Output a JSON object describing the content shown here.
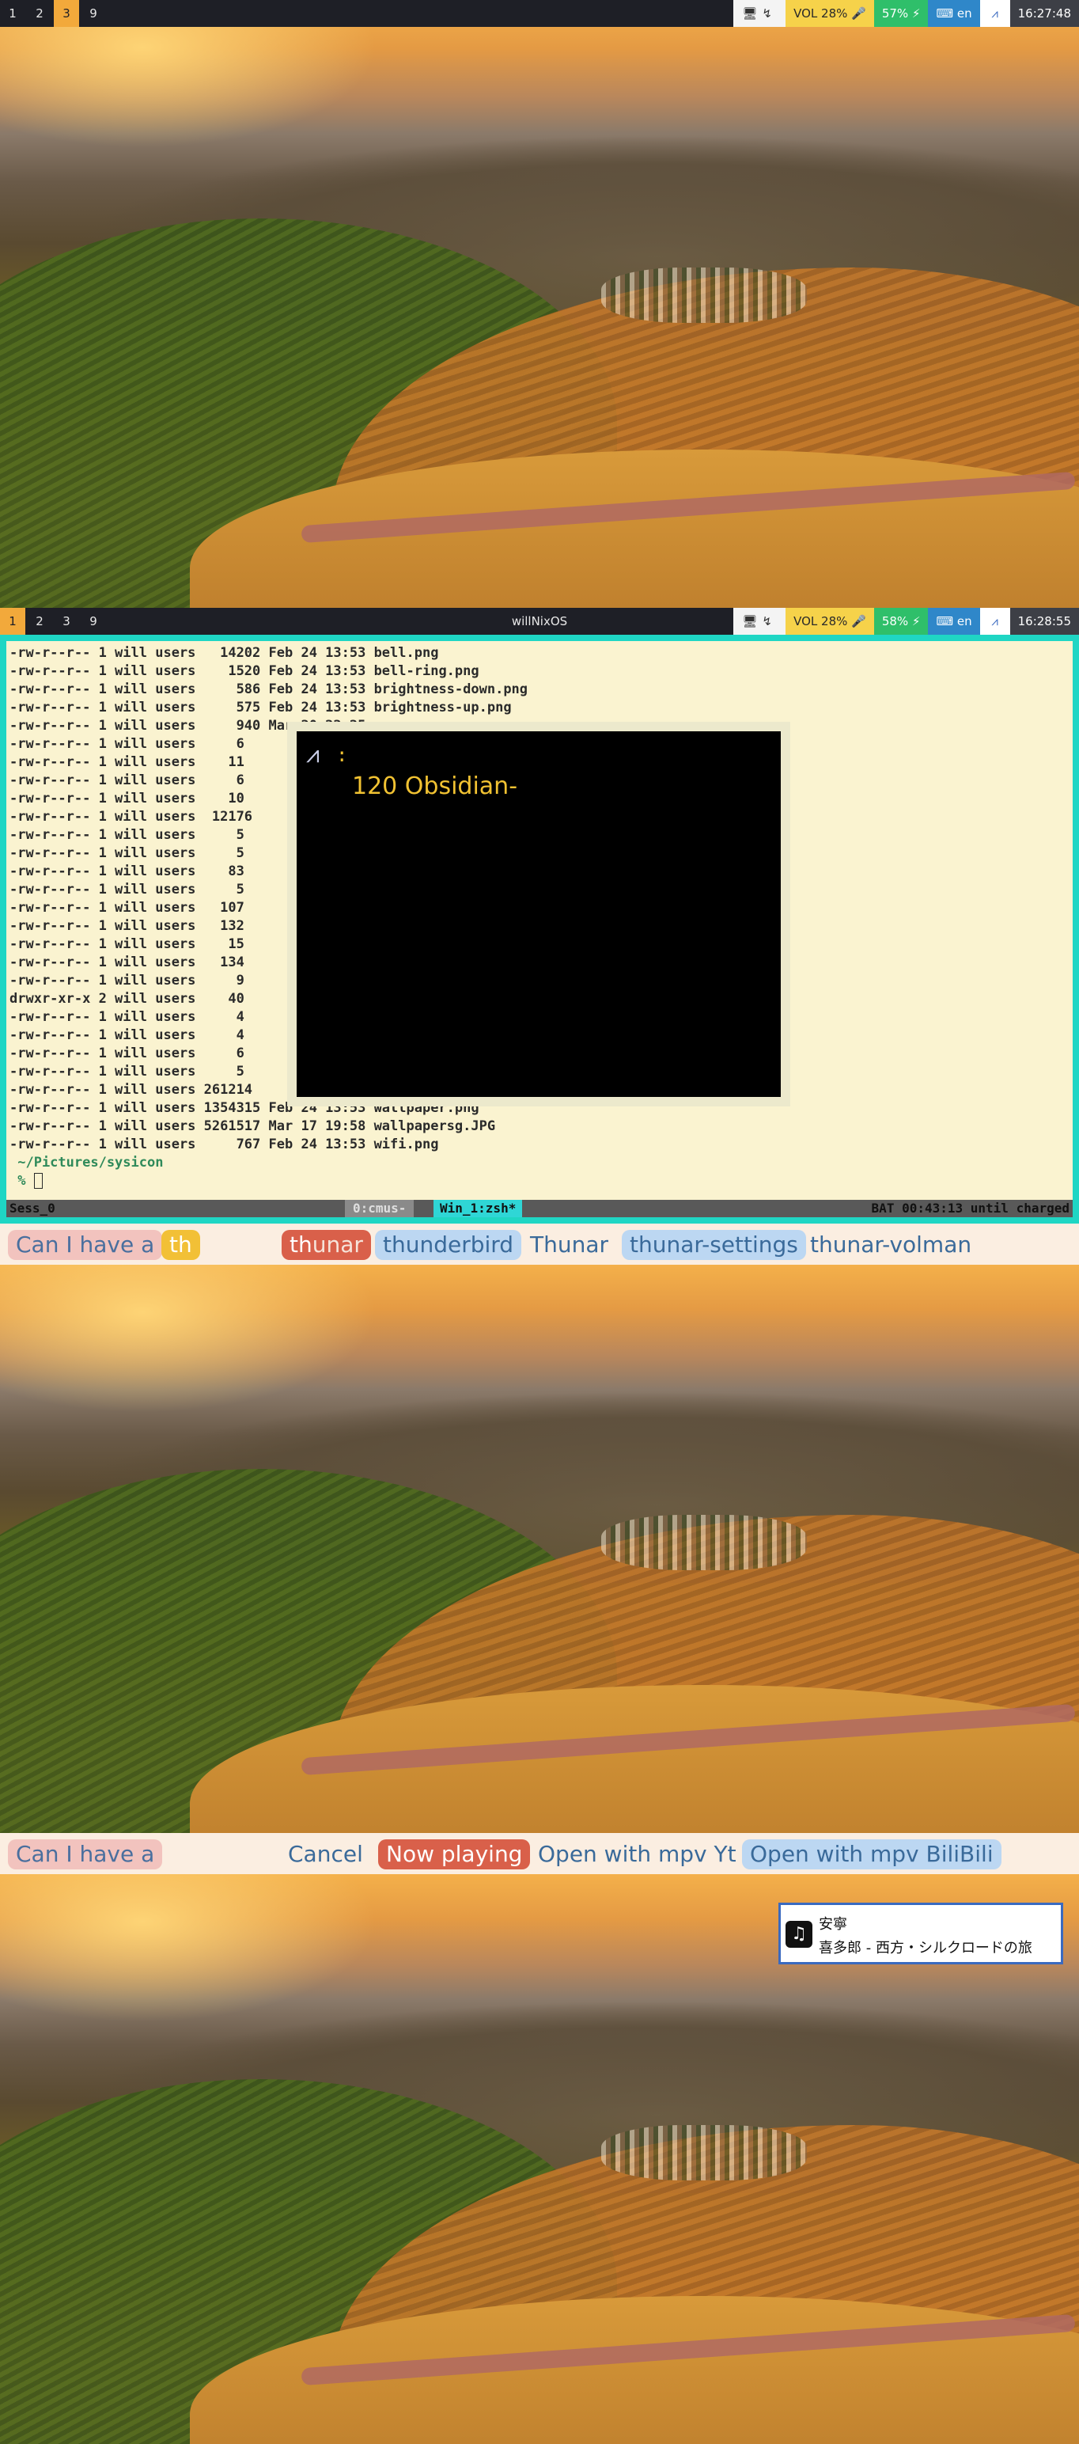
{
  "panel1": {
    "workspaces": [
      {
        "label": "1",
        "active": false
      },
      {
        "label": "2",
        "active": false
      },
      {
        "label": "3",
        "active": true
      },
      {
        "label": "9",
        "active": false
      }
    ],
    "tray": {
      "vol": "VOL 28% 🎤",
      "battery": "57% ⚡",
      "lang": "en",
      "clock": "16:27:48"
    }
  },
  "panel2": {
    "workspaces": [
      {
        "label": "1",
        "active": true
      },
      {
        "label": "2",
        "active": false
      },
      {
        "label": "3",
        "active": false
      },
      {
        "label": "9",
        "active": false
      }
    ],
    "title": "willNixOS",
    "tray": {
      "vol": "VOL 28% 🎤",
      "battery": "58% ⚡",
      "lang": "en",
      "clock": "16:28:55"
    },
    "terminal": {
      "lines": [
        "-rw-r--r-- 1 will users   14202 Feb 24 13:53 bell.png",
        "-rw-r--r-- 1 will users    1520 Feb 24 13:53 bell-ring.png",
        "-rw-r--r-- 1 will users     586 Feb 24 13:53 brightness-down.png",
        "-rw-r--r-- 1 will users     575 Feb 24 13:53 brightness-up.png",
        "-rw-r--r-- 1 will users     940 Mar 20 22:25 camera.png",
        "-rw-r--r-- 1 will users     6",
        "-rw-r--r-- 1 will users    11",
        "-rw-r--r-- 1 will users     6",
        "-rw-r--r-- 1 will users    10",
        "-rw-r--r-- 1 will users  12176",
        "-rw-r--r-- 1 will users     5",
        "-rw-r--r-- 1 will users     5",
        "-rw-r--r-- 1 will users    83",
        "-rw-r--r-- 1 will users     5",
        "-rw-r--r-- 1 will users   107",
        "-rw-r--r-- 1 will users   132",
        "-rw-r--r-- 1 will users    15",
        "-rw-r--r-- 1 will users   134",
        "-rw-r--r-- 1 will users     9",
        "drwxr-xr-x 2 will users    40",
        "-rw-r--r-- 1 will users     4",
        "-rw-r--r-- 1 will users     4",
        "-rw-r--r-- 1 will users     6",
        "-rw-r--r-- 1 will users     5",
        "-rw-r--r-- 1 will users 261214",
        "-rw-r--r-- 1 will users 1354315 Feb 24 13:53 wallpaper.png",
        "-rw-r--r-- 1 will users 5261517 Mar 17 19:58 wallpapersg.JPG",
        "-rw-r--r-- 1 will users     767 Feb 24 13:53 wifi.png"
      ],
      "cwd": " ~/Pictures/sysicon",
      "prompt": " %",
      "tmux": {
        "session": "Sess_0",
        "win0": "0:cmus-",
        "win1": "Win_1:zsh*",
        "battery": "BAT 00:43:13 until charged"
      }
    },
    "popup": {
      "colon": ":",
      "item": "120  Obsidian-"
    }
  },
  "launcher1": {
    "prompt": "Can I have a",
    "input": "th",
    "options": [
      "thunar",
      "thunderbird",
      "Thunar",
      "thunar-settings",
      "thunar-volman"
    ]
  },
  "launcher2": {
    "prompt": "Can I have a",
    "options": [
      "Cancel",
      "Now playing",
      "Open with mpv Yt",
      "Open with mpv BiliBili"
    ]
  },
  "notification": {
    "title": "安寧",
    "body": "喜多郎 - 西方・シルクロードの旅"
  }
}
